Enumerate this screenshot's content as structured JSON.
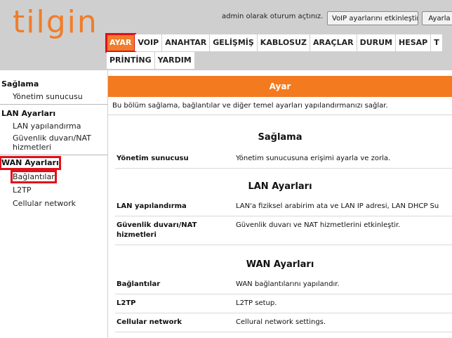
{
  "header": {
    "logo": "tilgin",
    "login_text": "admin olarak oturum açtınız.",
    "voip_button": "VoIP ayarlarını etkinleştir",
    "other_button": "Ayarla"
  },
  "nav": {
    "row1": [
      "AYAR",
      "VOIP",
      "ANAHTAR",
      "GELİŞMİŞ",
      "KABLOSUZ",
      "ARAÇLAR",
      "DURUM",
      "HESAP",
      "T"
    ],
    "row2": [
      "PRİNTİNG",
      "YARDIM"
    ]
  },
  "sidebar": {
    "sections": [
      {
        "head": "Sağlama",
        "items": [
          "Yönetim sunucusu"
        ]
      },
      {
        "head": "LAN Ayarları",
        "items": [
          "LAN yapılandırma",
          "Güvenlik duvarı/NAT hizmetleri"
        ]
      },
      {
        "head": "WAN Ayarları",
        "items": [
          "Bağlantılar",
          "L2TP",
          "Cellular network"
        ]
      }
    ]
  },
  "main": {
    "title": "Ayar",
    "intro": "Bu bölüm sağlama, bağlantılar ve diğer temel ayarları yapılandırmanızı sağlar.",
    "sections": [
      {
        "title": "Sağlama",
        "rows": [
          {
            "label": "Yönetim sunucusu",
            "desc": "Yönetim sunucusuna erişimi ayarla ve zorla."
          }
        ]
      },
      {
        "title": "LAN Ayarları",
        "rows": [
          {
            "label": "LAN yapılandırma",
            "desc": "LAN'a fiziksel arabirim ata ve LAN IP adresi, LAN DHCP Su"
          },
          {
            "label": "Güvenlik duvarı/NAT hizmetleri",
            "desc": "Güvenlik duvarı ve NAT hizmetlerini etkinleştir."
          }
        ]
      },
      {
        "title": "WAN Ayarları",
        "rows": [
          {
            "label": "Bağlantılar",
            "desc": "WAN bağlantılarını yapılandır."
          },
          {
            "label": "L2TP",
            "desc": "L2TP setup."
          },
          {
            "label": "Cellular network",
            "desc": "Cellural network settings."
          }
        ]
      }
    ]
  },
  "colors": {
    "accent": "#f37a1f",
    "highlight": "#e0101a",
    "header_bg": "#cfcfcf"
  }
}
